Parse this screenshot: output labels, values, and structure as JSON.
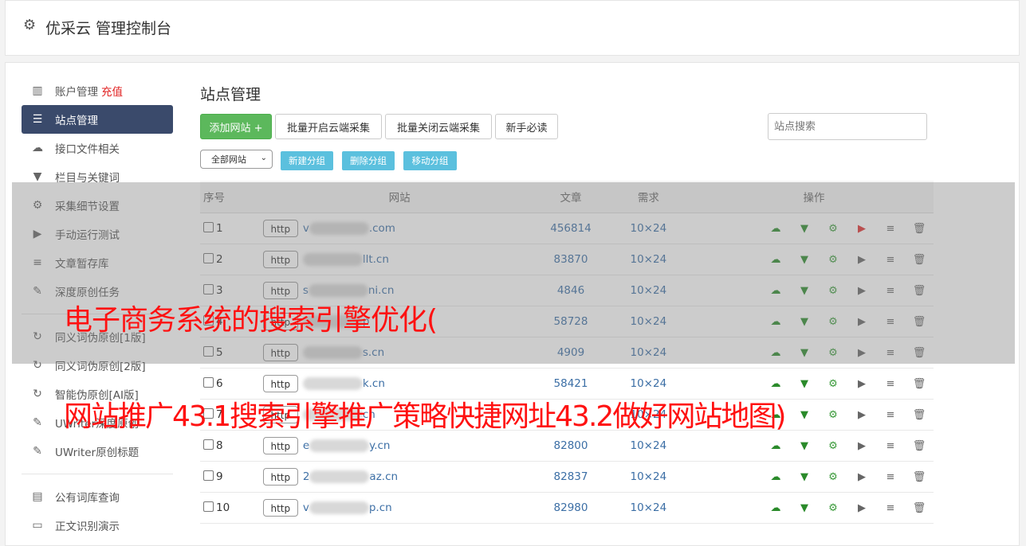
{
  "header": {
    "title": "优采云 管理控制台",
    "icon": "gear-icon"
  },
  "sidebar": {
    "items": [
      {
        "label": "账户管理",
        "badge": "充值",
        "icon": "bar-chart-icon"
      },
      {
        "label": "站点管理",
        "icon": "server-icon",
        "active": true
      },
      {
        "label": "接口文件相关",
        "icon": "cloud-upload-icon"
      },
      {
        "label": "栏目与关键词",
        "icon": "filter-icon"
      },
      {
        "label": "采集细节设置",
        "icon": "cogs-icon"
      },
      {
        "label": "手动运行测试",
        "icon": "play-circle-icon"
      },
      {
        "label": "文章暂存库",
        "icon": "database-icon"
      },
      {
        "label": "深度原创任务",
        "icon": "edit-icon"
      },
      {
        "label": "同义词伪原创[1版]",
        "icon": "refresh-icon"
      },
      {
        "label": "同义词伪原创[2版]",
        "icon": "refresh-icon"
      },
      {
        "label": "智能伪原创[AI版]",
        "icon": "refresh-icon"
      },
      {
        "label": "UWriter深度原创",
        "icon": "edit-icon"
      },
      {
        "label": "UWriter原创标题",
        "icon": "edit-icon"
      },
      {
        "label": "公有词库查询",
        "icon": "book-icon"
      },
      {
        "label": "正文识别演示",
        "icon": "monitor-icon"
      }
    ]
  },
  "main": {
    "title": "站点管理",
    "add_button": "添加网站 +",
    "batch_on": "批量开启云端采集",
    "batch_off": "批量关闭云端采集",
    "guide": "新手必读",
    "search_placeholder": "站点搜索",
    "group_select": "全部网站",
    "new_group": "新建分组",
    "delete_group": "删除分组",
    "move_group": "移动分组"
  },
  "table": {
    "headers": {
      "idx": "序号",
      "site": "网站",
      "articles": "文章",
      "req": "需求",
      "ops": "操作"
    },
    "rows": [
      {
        "idx": "1",
        "proto": "http",
        "url_prefix": "v",
        "url": ".com",
        "articles": "456814",
        "req": "10×24",
        "play_red": true
      },
      {
        "idx": "2",
        "proto": "http",
        "url_prefix": "",
        "url": "llt.cn",
        "articles": "83870",
        "req": "10×24"
      },
      {
        "idx": "3",
        "proto": "http",
        "url_prefix": "s",
        "url": "ni.cn",
        "articles": "4846",
        "req": "10×24"
      },
      {
        "idx": "4",
        "proto": "http",
        "url_prefix": "",
        "url": "p",
        "articles": "58728",
        "req": "10×24"
      },
      {
        "idx": "5",
        "proto": "http",
        "url_prefix": "",
        "url": "s.cn",
        "articles": "4909",
        "req": "10×24"
      },
      {
        "idx": "6",
        "proto": "http",
        "url_prefix": "",
        "url": "k.cn",
        "articles": "58421",
        "req": "10×24"
      },
      {
        "idx": "7",
        "proto": "http",
        "url_prefix": "",
        "url": "cn",
        "articles": "",
        "req": "10×24"
      },
      {
        "idx": "8",
        "proto": "http",
        "url_prefix": "e",
        "url": "y.cn",
        "articles": "82800",
        "req": "10×24"
      },
      {
        "idx": "9",
        "proto": "http",
        "url_prefix": "2",
        "url": "az.cn",
        "articles": "82837",
        "req": "10×24"
      },
      {
        "idx": "10",
        "proto": "http",
        "url_prefix": "v",
        "url": "p.cn",
        "articles": "82980",
        "req": "10×24"
      }
    ]
  },
  "overlay": {
    "line1": "电子商务系统的搜索引擎优化(",
    "line2": "网站推广43.1搜索引擎推广策略快捷网址43.2做好网站地图)"
  }
}
